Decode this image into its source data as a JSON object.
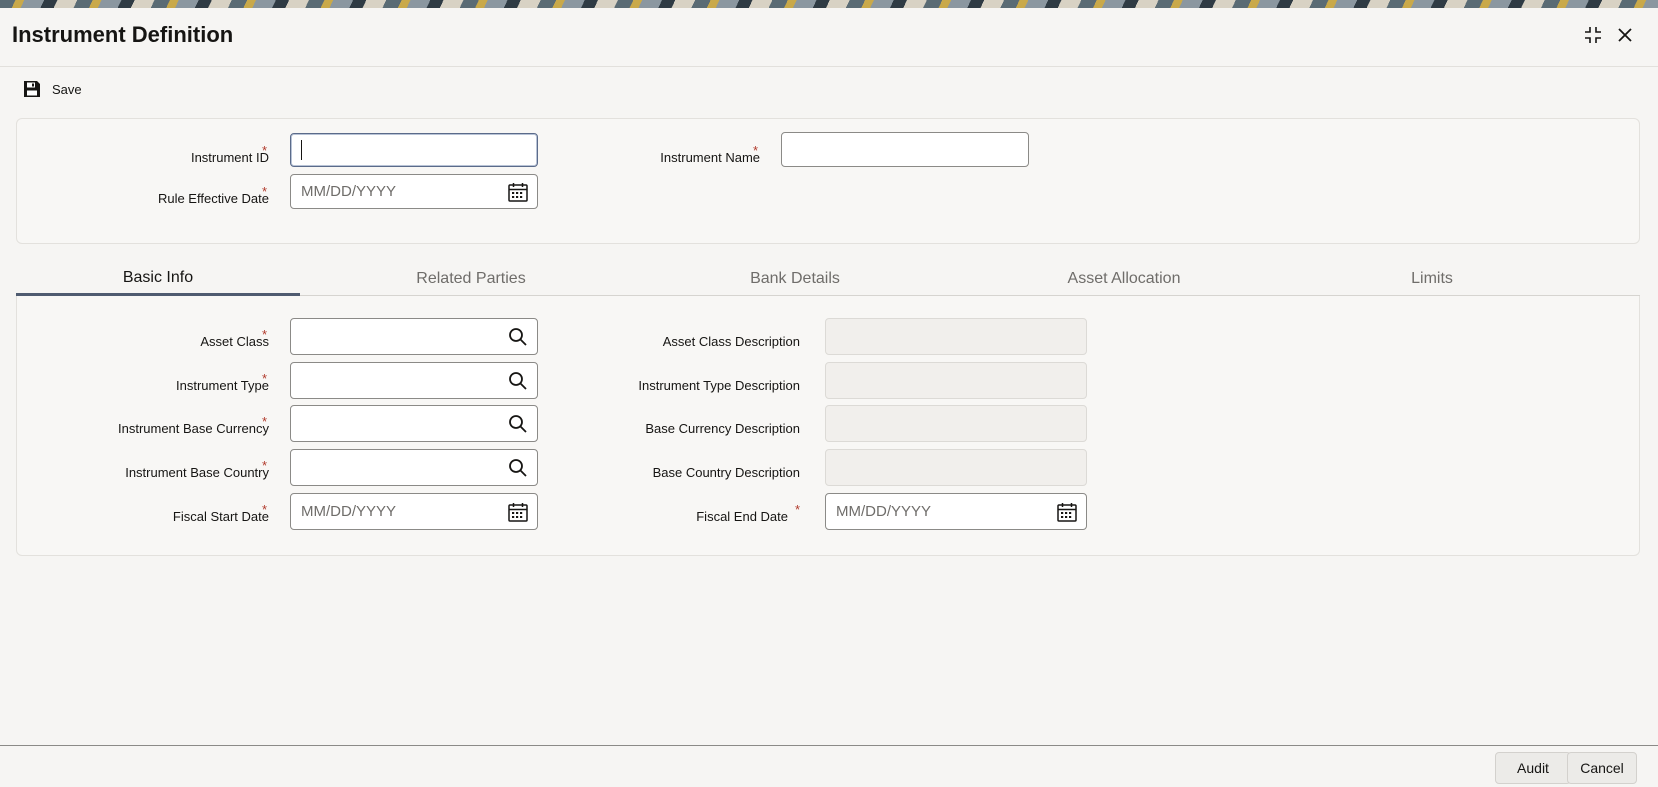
{
  "window": {
    "title": "Instrument Definition",
    "maximize_icon": "maximize-icon",
    "close_icon": "close-icon"
  },
  "toolbar": {
    "save_label": "Save",
    "save_icon": "floppy-disk-icon"
  },
  "header_form": {
    "instrument_id": {
      "label": "Instrument ID",
      "required": "*",
      "value": ""
    },
    "instrument_name": {
      "label": "Instrument Name",
      "required": "*",
      "value": ""
    },
    "rule_effective_date": {
      "label": "Rule Effective Date",
      "required": "*",
      "placeholder": "MM/DD/YYYY"
    }
  },
  "tabs": [
    {
      "label": "Basic Info",
      "active": true
    },
    {
      "label": "Related Parties"
    },
    {
      "label": "Bank Details"
    },
    {
      "label": "Asset Allocation"
    },
    {
      "label": "Limits"
    }
  ],
  "basic_info": {
    "asset_class": {
      "label": "Asset Class",
      "required": "*",
      "value": ""
    },
    "instrument_type": {
      "label": "Instrument Type",
      "required": "*",
      "value": ""
    },
    "instrument_base_currency": {
      "label": "Instrument Base Currency",
      "required": "*",
      "value": ""
    },
    "instrument_base_country": {
      "label": "Instrument Base Country",
      "required": "*",
      "value": ""
    },
    "fiscal_start_date": {
      "label": "Fiscal Start Date",
      "required": "*",
      "placeholder": "MM/DD/YYYY"
    },
    "asset_class_description": {
      "label": "Asset Class Description",
      "value": ""
    },
    "instrument_type_description": {
      "label": "Instrument Type Description",
      "value": ""
    },
    "base_currency_description": {
      "label": "Base Currency Description",
      "value": ""
    },
    "base_country_description": {
      "label": "Base Country Description",
      "value": ""
    },
    "fiscal_end_date": {
      "label": "Fiscal End Date",
      "required": "*",
      "placeholder": "MM/DD/YYYY"
    }
  },
  "footer": {
    "audit_label": "Audit",
    "cancel_label": "Cancel"
  },
  "colors": {
    "background": "#f6f5f3",
    "required_marker": "#b13a2c",
    "active_tab_underline": "#4f5b70"
  }
}
